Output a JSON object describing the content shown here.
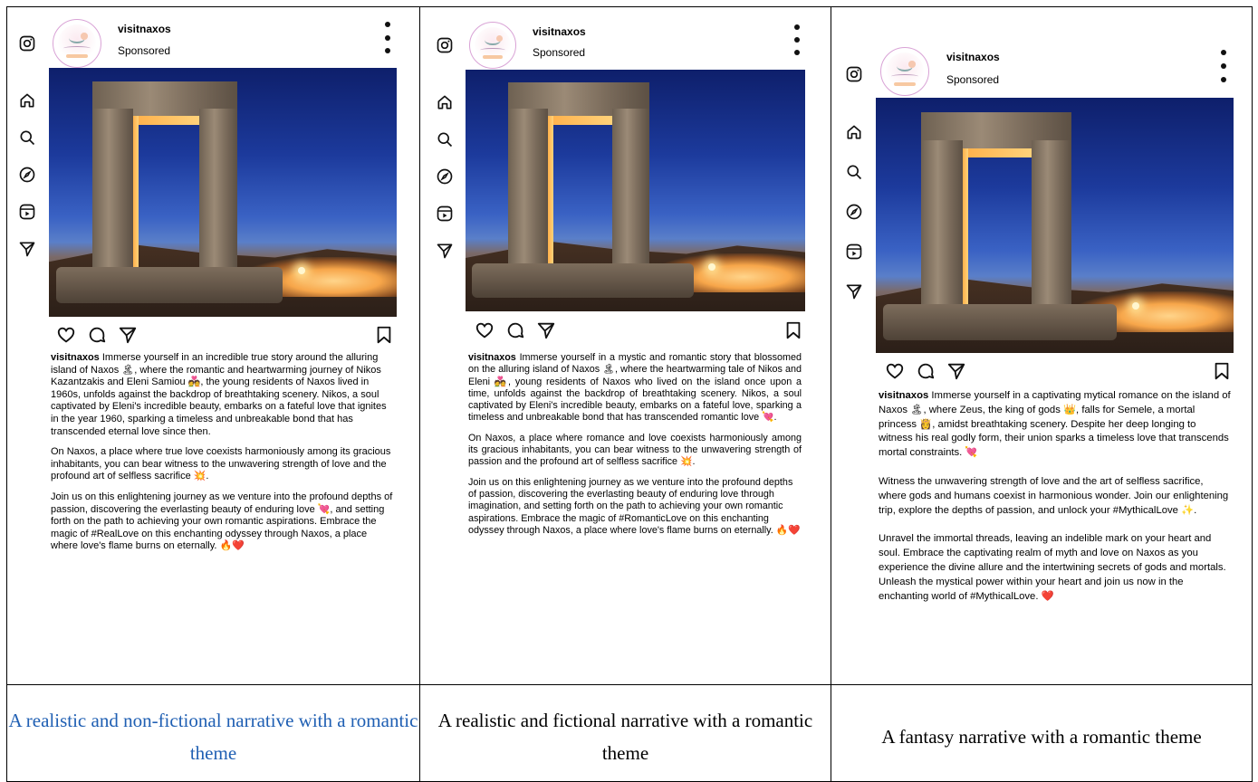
{
  "username": "visitnaxos",
  "sponsored_label": "Sponsored",
  "panels": [
    {
      "paragraphs": [
        "Immerse yourself in an incredible true story around the alluring island of Naxos 🏝, where the romantic and heartwarming journey of Nikos Kazantzakis and Eleni Samiou 💑, the young residents of Naxos lived in 1960s, unfolds against the backdrop of breathtaking scenery. Nikos, a soul captivated by Eleni's incredible beauty, embarks on a fateful love that ignites in the year 1960, sparking a timeless and unbreakable bond that has transcended eternal love since then.",
        "On Naxos, a place where true love coexists harmoniously among its gracious inhabitants, you can bear witness to the unwavering strength of love and the profound art of selfless sacrifice 💥.",
        "Join us on this enlightening journey as we venture into the profound depths of passion, discovering the everlasting beauty of enduring love 💘, and setting forth on the path to achieving your own romantic aspirations. Embrace the magic of #RealLove on this enchanting odyssey through Naxos, a place where love's flame burns on eternally. 🔥❤️"
      ],
      "footer": "A realistic and non-fictional narrative with a romantic theme"
    },
    {
      "paragraphs": [
        "Immerse yourself in a mystic and romantic story that blossomed on the alluring island of Naxos 🏝, where the heartwarming tale of Nikos and Eleni 💑, young residents of Naxos who lived on the island once upon a time, unfolds against the backdrop of breathtaking scenery. Nikos, a soul captivated by Eleni's incredible beauty, embarks on a fateful love, sparking a timeless and unbreakable bond that has transcended romantic love 💘.",
        "On Naxos, a place where romance and love coexists harmoniously among its gracious inhabitants, you can bear witness to the unwavering strength of passion and the profound art of selfless sacrifice 💥.",
        "Join us on this enlightening journey as we venture into the profound depths of passion, discovering the everlasting beauty of enduring love through imagination, and setting forth on the path to achieving your own romantic aspirations. Embrace the magic of #RomanticLove on this enchanting odyssey through Naxos, a place where love's flame burns on eternally. 🔥❤️"
      ],
      "footer": "A realistic and fictional narrative with a romantic theme"
    },
    {
      "paragraphs": [
        "Immerse yourself in a captivating mytical romance on the island of Naxos 🏝, where Zeus, the king of gods 👑, falls for Semele, a mortal princess 👸, amidst breathtaking scenery. Despite her deep longing to witness his real godly form, their union sparks a timeless love that transcends mortal constraints. 💘",
        "Witness the unwavering strength of love and the art of selfless sacrifice, where gods and humans coexist in harmonious wonder. Join our enlightening trip, explore the depths of passion, and unlock your #MythicalLove ✨.",
        "Unravel the immortal threads, leaving an indelible mark on your heart and soul. Embrace the captivating realm of myth and love on Naxos as you experience the divine allure and the intertwining secrets of gods and mortals. Unleash the mystical power within your heart and join us now in the enchanting world of #MythicalLove. ❤️"
      ],
      "footer": "A fantasy narrative with a romantic theme"
    }
  ]
}
